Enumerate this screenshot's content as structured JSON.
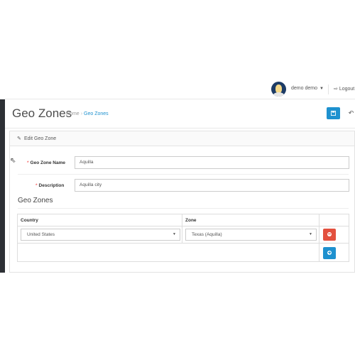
{
  "header": {
    "user_name": "demo demo",
    "user_caret": "▼",
    "logout_label": "Logout",
    "logout_icon": "sign-out-icon"
  },
  "page": {
    "title": "Geo Zones",
    "breadcrumb": [
      {
        "label": "Home"
      },
      {
        "label": "Geo Zones"
      }
    ],
    "save_icon": "floppy-icon",
    "back_icon": "reply-icon"
  },
  "panel": {
    "heading": "Edit Geo Zone",
    "fields": {
      "name_label": "Geo Zone Name",
      "name_value": "Aquilla",
      "description_label": "Description",
      "description_value": "Aquilla city"
    }
  },
  "zones": {
    "section_title": "Geo Zones",
    "columns": [
      "Country",
      "Zone",
      ""
    ],
    "rows": [
      {
        "country": "United States",
        "zone": "Texas (Aquilla)"
      }
    ]
  },
  "colors": {
    "primary": "#1e91cf",
    "danger": "#e3503e",
    "required": "#f56b6b",
    "sidebar": "#2d3035"
  }
}
